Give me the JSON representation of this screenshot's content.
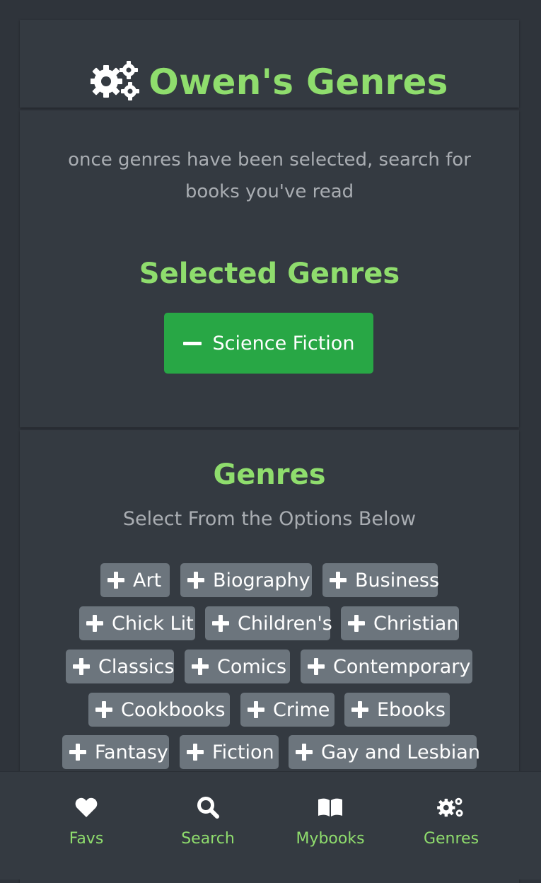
{
  "header": {
    "title": "Owen's Genres",
    "icon": "gears-icon"
  },
  "hint": "once genres have been selected, search for books you've read",
  "selected": {
    "title": "Selected Genres",
    "genres": [
      "Science Fiction"
    ]
  },
  "genres": {
    "title": "Genres",
    "subtitle": "Select From the Options Below",
    "options": [
      "Art",
      "Biography",
      "Business",
      "Chick Lit",
      "Children's",
      "Christian",
      "Classics",
      "Comics",
      "Contemporary",
      "Cookbooks",
      "Crime",
      "Ebooks",
      "Fantasy",
      "Fiction",
      "Gay and Lesbian"
    ]
  },
  "nav": {
    "items": [
      {
        "label": "Favs",
        "icon": "heart-icon"
      },
      {
        "label": "Search",
        "icon": "search-icon"
      },
      {
        "label": "Mybooks",
        "icon": "book-icon"
      },
      {
        "label": "Genres",
        "icon": "gears-icon"
      }
    ]
  },
  "colors": {
    "accent": "#8fdd6d",
    "background": "#2f343b",
    "card": "#343a41",
    "chip": "#6c757d",
    "selected": "#28a745"
  }
}
